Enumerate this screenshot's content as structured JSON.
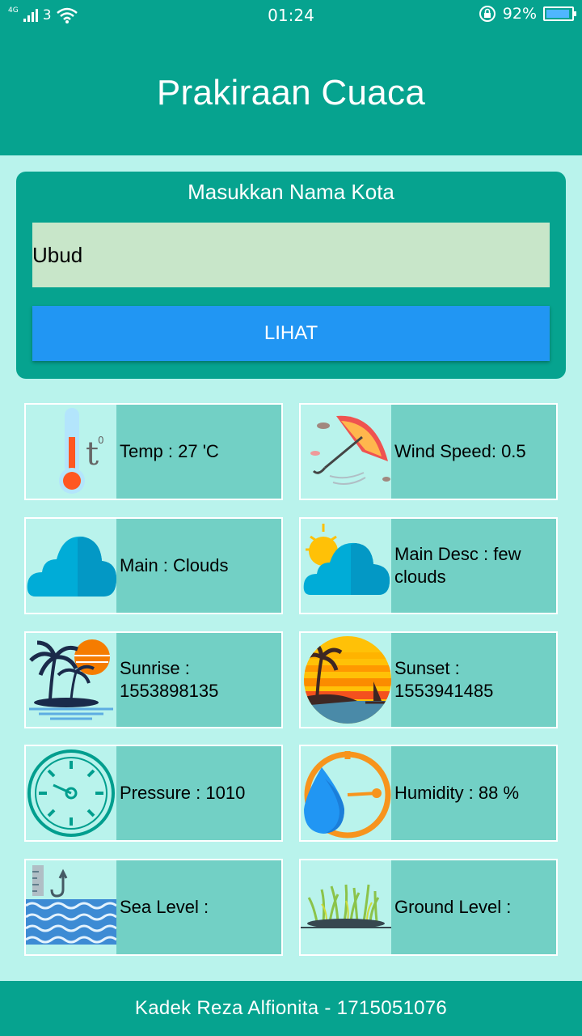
{
  "status_bar": {
    "network": "4G",
    "sim_slot": "3",
    "time": "01:24",
    "battery_percent": "92%",
    "icons": [
      "signal-icon",
      "wifi-icon",
      "rotation-lock-icon",
      "battery-icon"
    ]
  },
  "app_bar": {
    "title": "Prakiraan Cuaca"
  },
  "search": {
    "caption": "Masukkan Nama Kota",
    "city_value": "Ubud",
    "button_label": "LIHAT"
  },
  "tiles": {
    "temp": {
      "label": "Temp : 27 'C",
      "icon": "thermometer-icon"
    },
    "wind": {
      "label": "Wind Speed: 0.5",
      "icon": "umbrella-wind-icon"
    },
    "main": {
      "label": "Main : Clouds",
      "icon": "cloud-icon"
    },
    "main_desc": {
      "label": "Main Desc : few clouds",
      "icon": "sun-cloud-icon"
    },
    "sunrise": {
      "label": "Sunrise : 1553898135",
      "icon": "palm-island-icon"
    },
    "sunset": {
      "label": "Sunset : 1553941485",
      "icon": "sunset-beach-icon"
    },
    "pressure": {
      "label": "Pressure : 1010",
      "icon": "gauge-icon"
    },
    "humidity": {
      "label": "Humidity : 88 %",
      "icon": "humidity-drop-icon"
    },
    "sea_level": {
      "label": "Sea Level :",
      "icon": "sea-level-icon"
    },
    "ground_level": {
      "label": "Ground Level :",
      "icon": "grass-ground-icon"
    }
  },
  "footer": {
    "text": "Kadek Reza Alfionita - 1715051076"
  },
  "colors": {
    "primary": "#06a38f",
    "background": "#b9f3ec",
    "input_bg": "#c8e6c9",
    "button": "#2196f3",
    "tile": "#72d0c5"
  }
}
